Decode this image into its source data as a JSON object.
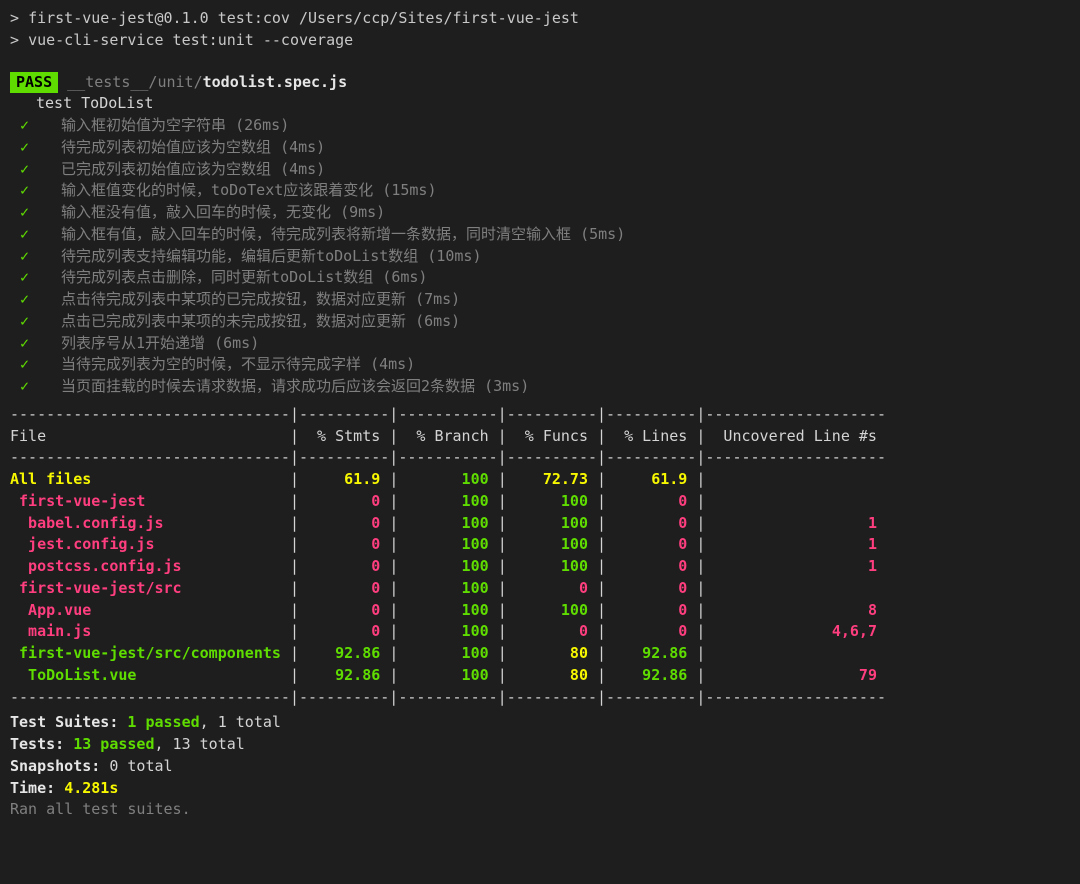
{
  "cmd1_prefix": "> ",
  "cmd1": "first-vue-jest@0.1.0 test:cov /Users/ccp/Sites/first-vue-jest",
  "cmd2_prefix": "> ",
  "cmd2": "vue-cli-service test:unit --coverage",
  "pass_label": " PASS ",
  "spec_dim": " __tests__/unit/",
  "spec_bold": "todolist.spec.js",
  "suite_name": "test ToDoList",
  "tests": [
    "输入框初始值为空字符串 (26ms)",
    "待完成列表初始值应该为空数组 (4ms)",
    "已完成列表初始值应该为空数组 (4ms)",
    "输入框值变化的时候，toDoText应该跟着变化 (15ms)",
    "输入框没有值，敲入回车的时候，无变化 (9ms)",
    "输入框有值，敲入回车的时候，待完成列表将新增一条数据，同时清空输入框 (5ms)",
    "待完成列表支持编辑功能，编辑后更新toDoList数组 (10ms)",
    "待完成列表点击删除，同时更新toDoList数组 (6ms)",
    "点击待完成列表中某项的已完成按钮，数据对应更新 (7ms)",
    "点击已完成列表中某项的未完成按钮，数据对应更新 (6ms)",
    "列表序号从1开始递增 (6ms)",
    "当待完成列表为空的时候，不显示待完成字样 (4ms)",
    "当页面挂载的时候去请求数据，请求成功后应该会返回2条数据 (3ms)"
  ],
  "cov_header_file": "File",
  "cov_header_stmts": "% Stmts",
  "cov_header_branch": "% Branch",
  "cov_header_funcs": "% Funcs",
  "cov_header_lines": "% Lines",
  "cov_header_unc": "Uncovered Line #s",
  "rows": [
    {
      "file": "All files",
      "stmts": "61.9",
      "branch": "100",
      "funcs": "72.73",
      "lines": "61.9",
      "unc": "",
      "c": "yellow",
      "cs": "yellow",
      "cb": "green",
      "cf": "yellow",
      "cl": "yellow",
      "cu": "plain"
    },
    {
      "file": " first-vue-jest",
      "stmts": "0",
      "branch": "100",
      "funcs": "100",
      "lines": "0",
      "unc": "",
      "c": "red",
      "cs": "red",
      "cb": "green",
      "cf": "green",
      "cl": "red",
      "cu": "plain"
    },
    {
      "file": "  babel.config.js",
      "stmts": "0",
      "branch": "100",
      "funcs": "100",
      "lines": "0",
      "unc": "1",
      "c": "red",
      "cs": "red",
      "cb": "green",
      "cf": "green",
      "cl": "red",
      "cu": "red"
    },
    {
      "file": "  jest.config.js",
      "stmts": "0",
      "branch": "100",
      "funcs": "100",
      "lines": "0",
      "unc": "1",
      "c": "red",
      "cs": "red",
      "cb": "green",
      "cf": "green",
      "cl": "red",
      "cu": "red"
    },
    {
      "file": "  postcss.config.js",
      "stmts": "0",
      "branch": "100",
      "funcs": "100",
      "lines": "0",
      "unc": "1",
      "c": "red",
      "cs": "red",
      "cb": "green",
      "cf": "green",
      "cl": "red",
      "cu": "red"
    },
    {
      "file": " first-vue-jest/src",
      "stmts": "0",
      "branch": "100",
      "funcs": "0",
      "lines": "0",
      "unc": "",
      "c": "red",
      "cs": "red",
      "cb": "green",
      "cf": "red",
      "cl": "red",
      "cu": "plain"
    },
    {
      "file": "  App.vue",
      "stmts": "0",
      "branch": "100",
      "funcs": "100",
      "lines": "0",
      "unc": "8",
      "c": "red",
      "cs": "red",
      "cb": "green",
      "cf": "green",
      "cl": "red",
      "cu": "red"
    },
    {
      "file": "  main.js",
      "stmts": "0",
      "branch": "100",
      "funcs": "0",
      "lines": "0",
      "unc": "4,6,7",
      "c": "red",
      "cs": "red",
      "cb": "green",
      "cf": "red",
      "cl": "red",
      "cu": "red"
    },
    {
      "file": " first-vue-jest/src/components",
      "stmts": "92.86",
      "branch": "100",
      "funcs": "80",
      "lines": "92.86",
      "unc": "",
      "c": "green",
      "cs": "green",
      "cb": "green",
      "cf": "yellow",
      "cl": "green",
      "cu": "plain"
    },
    {
      "file": "  ToDoList.vue",
      "stmts": "92.86",
      "branch": "100",
      "funcs": "80",
      "lines": "92.86",
      "unc": "79",
      "c": "green",
      "cs": "green",
      "cb": "green",
      "cf": "yellow",
      "cl": "green",
      "cu": "red"
    }
  ],
  "sum_suites_label": "Test Suites: ",
  "sum_suites_pass": "1 passed",
  "sum_suites_rest": ", 1 total",
  "sum_tests_label": "Tests:       ",
  "sum_tests_pass": "13 passed",
  "sum_tests_rest": ", 13 total",
  "sum_snap_label": "Snapshots:   ",
  "sum_snap_rest": "0 total",
  "sum_time_label": "Time:        ",
  "sum_time_val": "4.281s",
  "ran_line": "Ran all test suites."
}
